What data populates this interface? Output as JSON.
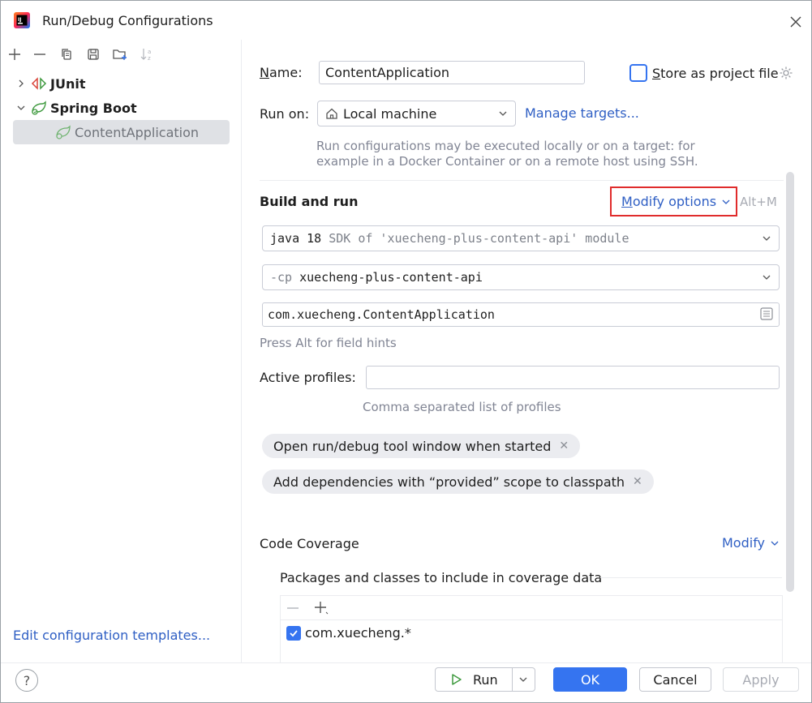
{
  "window": {
    "title": "Run/Debug Configurations"
  },
  "left": {
    "tree": [
      {
        "label": "JUnit"
      },
      {
        "label": "Spring Boot"
      },
      {
        "label": "ContentApplication"
      }
    ],
    "edit_templates": "Edit configuration templates..."
  },
  "form": {
    "name_label_underlined": "N",
    "name_label_rest": "ame:",
    "name_value": "ContentApplication",
    "store_label_underlined": "S",
    "store_label_rest": "tore as project file",
    "run_on_label": "Run on:",
    "run_on_value": "Local machine",
    "manage_targets": "Manage targets...",
    "run_on_hint_1": "Run configurations may be executed locally or on a target: for",
    "run_on_hint_2": "example in a Docker Container or on a remote host using SSH."
  },
  "build_run": {
    "title": "Build and run",
    "modify_underlined": "M",
    "modify_rest": "odify options",
    "shortcut": "Alt+M",
    "jdk_strong": "java 18",
    "jdk_rest": "SDK of 'xuecheng-plus-content-api' module",
    "cp_prefix": "-cp",
    "cp_value": "xuecheng-plus-content-api",
    "main_class": "com.xuecheng.ContentApplication",
    "press_alt_hint": "Press Alt for field hints",
    "active_profiles_label": "Active profiles:",
    "active_profiles_value": "",
    "active_profiles_hint": "Comma separated list of profiles",
    "chips": [
      {
        "label": "Open run/debug tool window when started"
      },
      {
        "label": "Add dependencies with “provided” scope to classpath"
      }
    ]
  },
  "coverage": {
    "title": "Code Coverage",
    "modify": "Modify",
    "packages_label": "Packages and classes to include in coverage data",
    "items": [
      {
        "label": "com.xuecheng.*",
        "checked": true
      }
    ]
  },
  "buttons": {
    "run": "Run",
    "ok": "OK",
    "cancel": "Cancel",
    "apply": "Apply",
    "help": "?"
  },
  "colors": {
    "accent": "#3574f0",
    "link": "#2f5fc4",
    "highlight_border": "#e02c2c",
    "spring_green": "#3f9a3f",
    "junit_red": "#d9453a"
  }
}
